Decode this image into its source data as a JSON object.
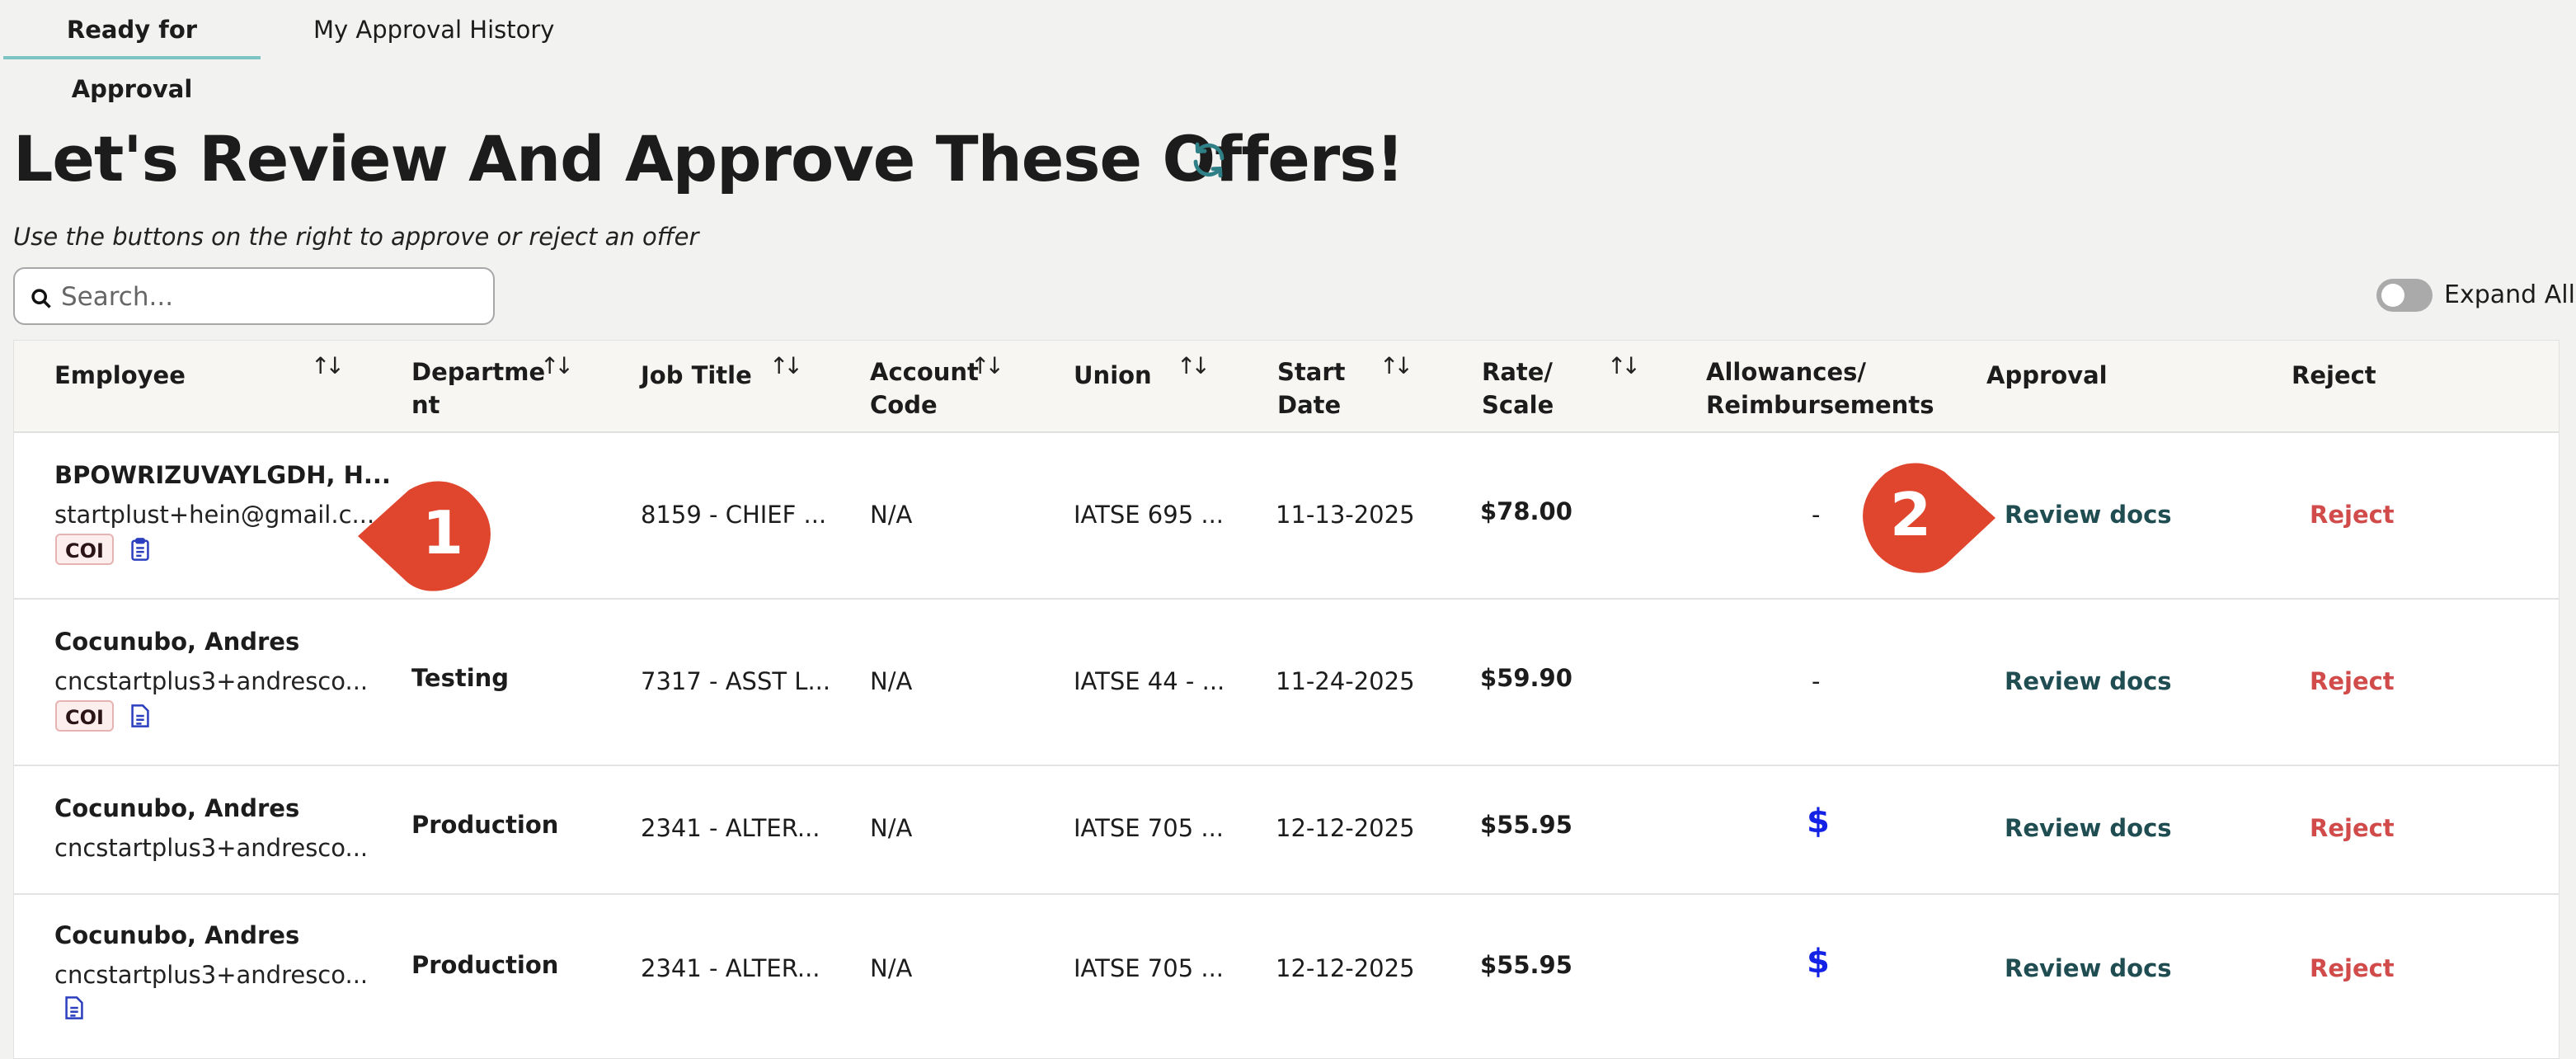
{
  "tabs": [
    {
      "label": "Ready for Approval",
      "active": true
    },
    {
      "label": "My Approval History",
      "active": false
    }
  ],
  "page": {
    "title": "Let's Review And Approve These Offers!",
    "subtitle": "Use the buttons on the right to approve or reject an offer"
  },
  "search": {
    "placeholder": "Search...",
    "value": ""
  },
  "expand_all": {
    "label": "Expand All",
    "on": false
  },
  "columns": [
    "Employee",
    "Departme\nnt",
    "Job Title",
    "Account\nCode",
    "Union",
    "Start\nDate",
    "Rate/\nScale",
    "Allowances/\nReimbursements",
    "Approval",
    "Reject"
  ],
  "rows": [
    {
      "name": "BPOWRIZUVAYLGDH, H...",
      "email": "startplust+hein@gmail.c...",
      "coi": "COI",
      "department": "",
      "job_title": "8159 - CHIEF ...",
      "account_code": "N/A",
      "union": "IATSE 695 ...",
      "start_date": "11-13-2025",
      "rate": "$78.00",
      "allowances": "-",
      "approval": "Review docs",
      "reject": "Reject"
    },
    {
      "name": "Cocunubo, Andres",
      "email": "cncstartplus3+andresco...",
      "coi": "COI",
      "department": "Testing",
      "job_title": "7317 - ASST L...",
      "account_code": "N/A",
      "union": "IATSE 44 - ...",
      "start_date": "11-24-2025",
      "rate": "$59.90",
      "allowances": "-",
      "approval": "Review docs",
      "reject": "Reject"
    },
    {
      "name": "Cocunubo, Andres",
      "email": "cncstartplus3+andresco...",
      "coi": "",
      "department": "Production",
      "job_title": "2341 - ALTER...",
      "account_code": "N/A",
      "union": "IATSE 705 ...",
      "start_date": "12-12-2025",
      "rate": "$55.95",
      "allowances": "$",
      "approval": "Review docs",
      "reject": "Reject"
    },
    {
      "name": "Cocunubo, Andres",
      "email": "cncstartplus3+andresco...",
      "coi": "",
      "department": "Production",
      "job_title": "2341 - ALTER...",
      "account_code": "N/A",
      "union": "IATSE 705 ...",
      "start_date": "12-12-2025",
      "rate": "$55.95",
      "allowances": "$",
      "approval": "Review docs",
      "reject": "Reject"
    }
  ],
  "markers": [
    "1",
    "2"
  ],
  "colors": {
    "accent_tab": "#7dc5c5",
    "review": "#1f4d52",
    "reject": "#d24b4b",
    "marker": "#e0452e",
    "dollar": "#1422e6"
  }
}
